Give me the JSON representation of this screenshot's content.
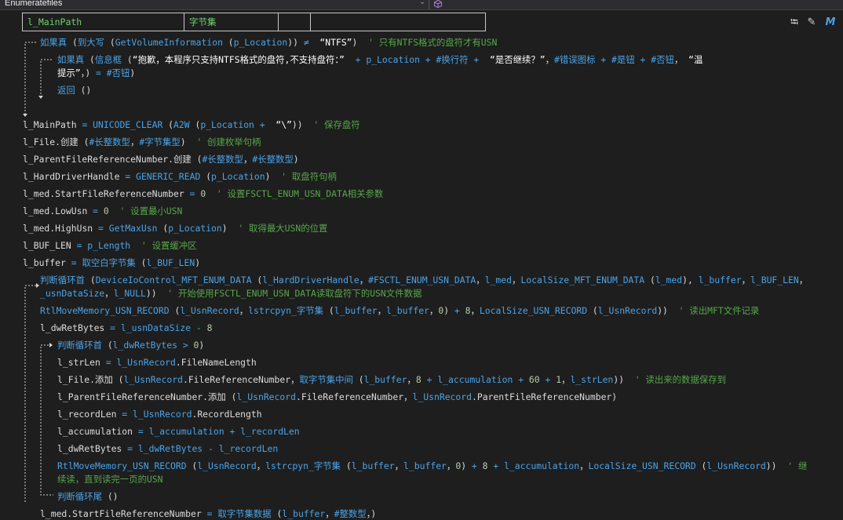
{
  "window": {
    "title": "Enumeratefiles",
    "dropdown_arrow": "⌄",
    "cube_icon": "cube-icon"
  },
  "var_table": {
    "cells": [
      "l_MainPath",
      "字节集",
      "",
      ""
    ]
  },
  "toolbar": {
    "icons": [
      "format-icon",
      "edit-icon",
      "m-icon"
    ],
    "glyphs": [
      "⭾",
      "✎",
      "M"
    ]
  },
  "colors": {
    "keyword": "#4aa3e8",
    "comment": "#57a64a",
    "text": "#dcdcdc",
    "background": "#1e1e1e",
    "var_table_text": "#6fd26f"
  },
  "code_lines": [
    [
      [
        "kw",
        "如果真 "
      ],
      [
        "p",
        "("
      ],
      [
        "kw",
        "到大写 "
      ],
      [
        "p",
        "("
      ],
      [
        "kw",
        "GetVolumeInformation "
      ],
      [
        "p",
        "("
      ],
      [
        "kw",
        "p_Location"
      ],
      [
        "p",
        ")) "
      ],
      [
        "op",
        "≠ "
      ],
      [
        "p",
        " "
      ],
      [
        "str",
        "“NTFS”"
      ],
      [
        "p",
        ") "
      ],
      [
        "cm",
        " ' 只有NTFS格式的盘符才有USN"
      ]
    ],
    [
      [
        "kw",
        "如果真 "
      ],
      [
        "p",
        "("
      ],
      [
        "kw",
        "信息框 "
      ],
      [
        "p",
        "("
      ],
      [
        "str",
        "“抱歉，本程序只支持NTFS格式的盘符,不支持盘符：” "
      ],
      [
        "op",
        " + "
      ],
      [
        "kw",
        "p_Location "
      ],
      [
        "op",
        "+ "
      ],
      [
        "kw",
        "#换行符 "
      ],
      [
        "op",
        "+ "
      ],
      [
        "str",
        " “是否继续？”"
      ],
      [
        "p",
        "，"
      ],
      [
        "kw",
        "#错误图标 "
      ],
      [
        "op",
        "+ "
      ],
      [
        "kw",
        "#是钮 "
      ],
      [
        "op",
        "+ "
      ],
      [
        "kw",
        "#否钮"
      ],
      [
        "p",
        "，"
      ],
      [
        "str",
        " “温"
      ]
    ],
    [
      [
        "str",
        "提示”"
      ],
      [
        "p",
        "，) "
      ],
      [
        "op",
        "= "
      ],
      [
        "kw",
        "#否钮"
      ],
      [
        "p",
        ")"
      ]
    ],
    [
      [
        "kw",
        "返回 "
      ],
      [
        "p",
        "()"
      ]
    ],
    [
      [
        "var",
        "l_MainPath "
      ],
      [
        "op",
        "= "
      ],
      [
        "kw",
        "UNICODE_CLEAR "
      ],
      [
        "p",
        "("
      ],
      [
        "kw",
        "A2W "
      ],
      [
        "p",
        "("
      ],
      [
        "kw",
        "p_Location "
      ],
      [
        "op",
        "+ "
      ],
      [
        "str",
        " “\\”"
      ],
      [
        "p",
        ")) "
      ],
      [
        "cm",
        " ' 保存盘符"
      ]
    ],
    [
      [
        "var",
        "l_File"
      ],
      [
        "p",
        "."
      ],
      [
        "cn",
        "创建 "
      ],
      [
        "p",
        "("
      ],
      [
        "kw",
        "#长整数型"
      ],
      [
        "p",
        "，"
      ],
      [
        "kw",
        "#字节集型"
      ],
      [
        "p",
        ") "
      ],
      [
        "cm",
        " ' 创建枚举句柄"
      ]
    ],
    [
      [
        "var",
        "l_ParentFileReferenceNumber"
      ],
      [
        "p",
        "."
      ],
      [
        "cn",
        "创建 "
      ],
      [
        "p",
        "("
      ],
      [
        "kw",
        "#长整数型"
      ],
      [
        "p",
        "，"
      ],
      [
        "kw",
        "#长整数型"
      ],
      [
        "p",
        ")"
      ]
    ],
    [
      [
        "var",
        "l_HardDriverHandle "
      ],
      [
        "op",
        "= "
      ],
      [
        "kw",
        "GENERIC_READ "
      ],
      [
        "p",
        "("
      ],
      [
        "kw",
        "p_Location"
      ],
      [
        "p",
        ") "
      ],
      [
        "cm",
        " ' 取盘符句柄"
      ]
    ],
    [
      [
        "var",
        "l_med"
      ],
      [
        "p",
        "."
      ],
      [
        "var",
        "StartFileReferenceNumber "
      ],
      [
        "op",
        "= "
      ],
      [
        "num",
        "0 "
      ],
      [
        "cm",
        " ' 设置FSCTL_ENUM_USN_DATA相关参数"
      ]
    ],
    [
      [
        "var",
        "l_med"
      ],
      [
        "p",
        "."
      ],
      [
        "var",
        "LowUsn "
      ],
      [
        "op",
        "= "
      ],
      [
        "num",
        "0 "
      ],
      [
        "cm",
        " ' 设置最小USN"
      ]
    ],
    [
      [
        "var",
        "l_med"
      ],
      [
        "p",
        "."
      ],
      [
        "var",
        "HighUsn "
      ],
      [
        "op",
        "= "
      ],
      [
        "kw",
        "GetMaxUsn "
      ],
      [
        "p",
        "("
      ],
      [
        "kw",
        "p_Location"
      ],
      [
        "p",
        ") "
      ],
      [
        "cm",
        " ' 取得最大USN的位置"
      ]
    ],
    [
      [
        "var",
        "l_BUF_LEN "
      ],
      [
        "op",
        "= "
      ],
      [
        "kw",
        "p_Length "
      ],
      [
        "cm",
        " ' 设置缓冲区"
      ]
    ],
    [
      [
        "var",
        "l_buffer "
      ],
      [
        "op",
        "= "
      ],
      [
        "kw",
        "取空白字节集 "
      ],
      [
        "p",
        "("
      ],
      [
        "kw",
        "l_BUF_LEN"
      ],
      [
        "p",
        ")"
      ]
    ],
    [
      [
        "kw",
        "判断循环首 "
      ],
      [
        "p",
        "("
      ],
      [
        "kw",
        "DeviceIoControl_MFT_ENUM_DATA "
      ],
      [
        "p",
        "("
      ],
      [
        "kw",
        "l_HardDriverHandle"
      ],
      [
        "p",
        "，"
      ],
      [
        "kw",
        "#FSCTL_ENUM_USN_DATA"
      ],
      [
        "p",
        "，"
      ],
      [
        "kw",
        "l_med"
      ],
      [
        "p",
        "，"
      ],
      [
        "kw",
        "LocalSize_MFT_ENUM_DATA "
      ],
      [
        "p",
        "("
      ],
      [
        "kw",
        "l_med"
      ],
      [
        "p",
        "), "
      ],
      [
        "kw",
        "l_buffer"
      ],
      [
        "p",
        "，"
      ],
      [
        "kw",
        "l_BUF_LEN"
      ],
      [
        "p",
        "，"
      ]
    ],
    [
      [
        "kw",
        "_usnDataSize"
      ],
      [
        "p",
        "，"
      ],
      [
        "kw",
        "l_NULL"
      ],
      [
        "p",
        ")) "
      ],
      [
        "cm",
        " ' 开始使用FSCTL_ENUM_USN_DATA读取盘符下的USN文件数据"
      ]
    ],
    [
      [
        "kw",
        "RtlMoveMemory_USN_RECORD "
      ],
      [
        "p",
        "("
      ],
      [
        "kw",
        "l_UsnRecord"
      ],
      [
        "p",
        "，"
      ],
      [
        "kw",
        "lstrcpyn_字节集 "
      ],
      [
        "p",
        "("
      ],
      [
        "kw",
        "l_buffer"
      ],
      [
        "p",
        "，"
      ],
      [
        "kw",
        "l_buffer"
      ],
      [
        "p",
        "，"
      ],
      [
        "num",
        "0"
      ],
      [
        "p",
        ") "
      ],
      [
        "op",
        "+ "
      ],
      [
        "num",
        "8"
      ],
      [
        "p",
        "，"
      ],
      [
        "kw",
        "LocalSize_USN_RECORD "
      ],
      [
        "p",
        "("
      ],
      [
        "kw",
        "l_UsnRecord"
      ],
      [
        "p",
        ")) "
      ],
      [
        "cm",
        " ' 读出MFT文件记录"
      ]
    ],
    [
      [
        "var",
        "l_dwRetBytes "
      ],
      [
        "op",
        "= "
      ],
      [
        "kw",
        "l_usnDataSize "
      ],
      [
        "op",
        "- "
      ],
      [
        "num",
        "8"
      ]
    ],
    [
      [
        "kw",
        "判断循环首 "
      ],
      [
        "p",
        "("
      ],
      [
        "kw",
        "l_dwRetBytes "
      ],
      [
        "op",
        "> "
      ],
      [
        "num",
        "0"
      ],
      [
        "p",
        ")"
      ]
    ],
    [
      [
        "var",
        "l_strLen "
      ],
      [
        "op",
        "= "
      ],
      [
        "kw",
        "l_UsnRecord"
      ],
      [
        "p",
        "."
      ],
      [
        "var",
        "FileNameLength"
      ]
    ],
    [
      [
        "var",
        "l_File"
      ],
      [
        "p",
        "."
      ],
      [
        "cn",
        "添加 "
      ],
      [
        "p",
        "("
      ],
      [
        "kw",
        "l_UsnRecord"
      ],
      [
        "p",
        "."
      ],
      [
        "var",
        "FileReferenceNumber"
      ],
      [
        "p",
        "，"
      ],
      [
        "kw",
        "取字节集中间 "
      ],
      [
        "p",
        "("
      ],
      [
        "kw",
        "l_buffer"
      ],
      [
        "p",
        "，"
      ],
      [
        "num",
        "8 "
      ],
      [
        "op",
        "+ "
      ],
      [
        "kw",
        "l_accumulation "
      ],
      [
        "op",
        "+ "
      ],
      [
        "num",
        "60 "
      ],
      [
        "op",
        "+ "
      ],
      [
        "num",
        "1"
      ],
      [
        "p",
        "，"
      ],
      [
        "kw",
        "l_strLen"
      ],
      [
        "p",
        ")) "
      ],
      [
        "cm",
        " ' 读出来的数据保存到"
      ]
    ],
    [
      [
        "var",
        "l_ParentFileReferenceNumber"
      ],
      [
        "p",
        "."
      ],
      [
        "cn",
        "添加 "
      ],
      [
        "p",
        "("
      ],
      [
        "kw",
        "l_UsnRecord"
      ],
      [
        "p",
        "."
      ],
      [
        "var",
        "FileReferenceNumber"
      ],
      [
        "p",
        "，"
      ],
      [
        "kw",
        "l_UsnRecord"
      ],
      [
        "p",
        "."
      ],
      [
        "var",
        "ParentFileReferenceNumber"
      ],
      [
        "p",
        ")"
      ]
    ],
    [
      [
        "var",
        "l_recordLen "
      ],
      [
        "op",
        "= "
      ],
      [
        "kw",
        "l_UsnRecord"
      ],
      [
        "p",
        "."
      ],
      [
        "var",
        "RecordLength"
      ]
    ],
    [
      [
        "var",
        "l_accumulation "
      ],
      [
        "op",
        "= "
      ],
      [
        "kw",
        "l_accumulation "
      ],
      [
        "op",
        "+ "
      ],
      [
        "kw",
        "l_recordLen"
      ]
    ],
    [
      [
        "var",
        "l_dwRetBytes "
      ],
      [
        "op",
        "= "
      ],
      [
        "kw",
        "l_dwRetBytes "
      ],
      [
        "op",
        "- "
      ],
      [
        "kw",
        "l_recordLen"
      ]
    ],
    [
      [
        "kw",
        "RtlMoveMemory_USN_RECORD "
      ],
      [
        "p",
        "("
      ],
      [
        "kw",
        "l_UsnRecord"
      ],
      [
        "p",
        "，"
      ],
      [
        "kw",
        "lstrcpyn_字节集 "
      ],
      [
        "p",
        "("
      ],
      [
        "kw",
        "l_buffer"
      ],
      [
        "p",
        "，"
      ],
      [
        "kw",
        "l_buffer"
      ],
      [
        "p",
        "，"
      ],
      [
        "num",
        "0"
      ],
      [
        "p",
        ") "
      ],
      [
        "op",
        "+ "
      ],
      [
        "num",
        "8 "
      ],
      [
        "op",
        "+ "
      ],
      [
        "kw",
        "l_accumulation"
      ],
      [
        "p",
        "，"
      ],
      [
        "kw",
        "LocalSize_USN_RECORD "
      ],
      [
        "p",
        "("
      ],
      [
        "kw",
        "l_UsnRecord"
      ],
      [
        "p",
        ")) "
      ],
      [
        "cm",
        " ' 继"
      ]
    ],
    [
      [
        "cm",
        "续读，直到读完一页的USN"
      ]
    ],
    [
      [
        "kw",
        "判断循环尾 "
      ],
      [
        "p",
        "()"
      ]
    ],
    [
      [
        "var",
        "l_med"
      ],
      [
        "p",
        "."
      ],
      [
        "var",
        "StartFileReferenceNumber "
      ],
      [
        "op",
        "= "
      ],
      [
        "kw",
        "取字节集数据 "
      ],
      [
        "p",
        "("
      ],
      [
        "kw",
        "l_buffer"
      ],
      [
        "p",
        "，"
      ],
      [
        "kw",
        "#整数型"
      ],
      [
        "p",
        "，)"
      ]
    ]
  ]
}
